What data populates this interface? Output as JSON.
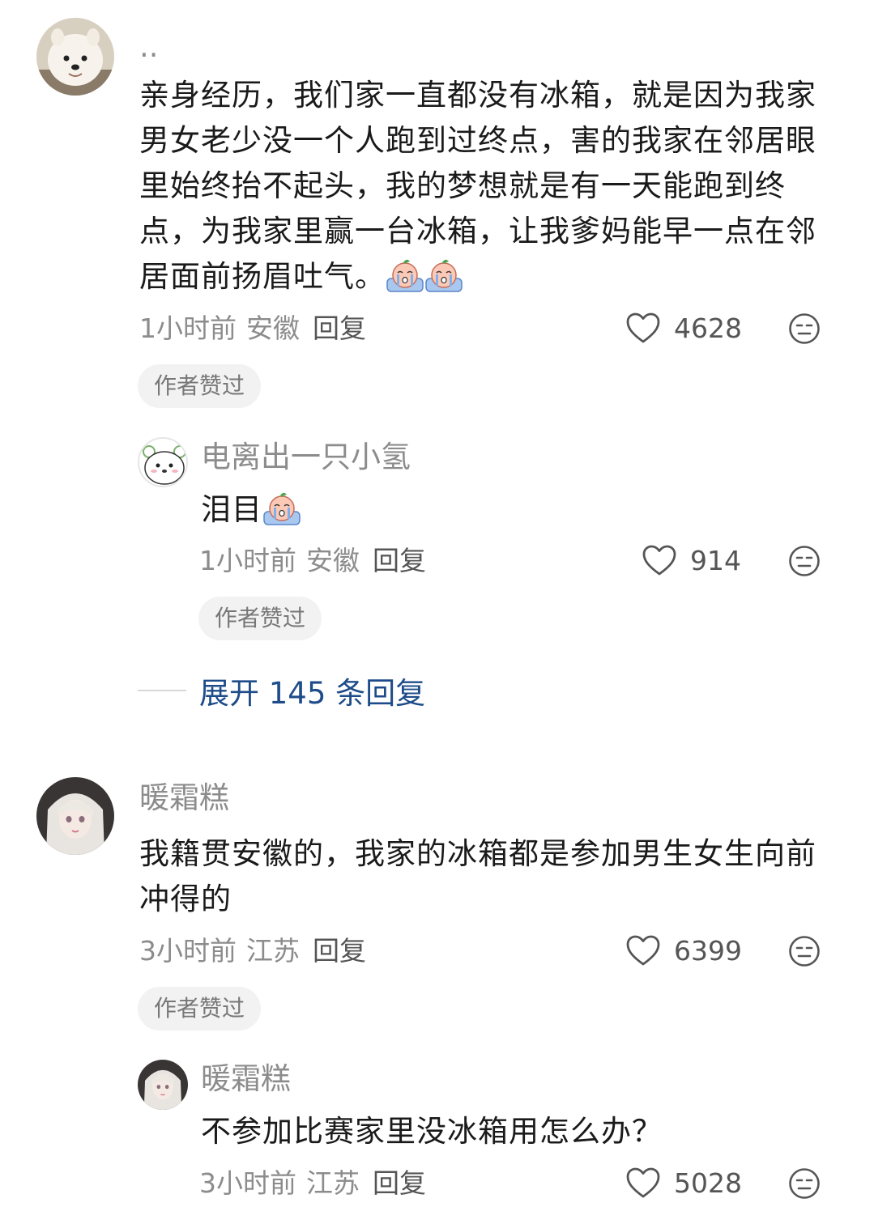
{
  "comments": [
    {
      "username": "..",
      "avatar_icon": "samoyed-dog-avatar",
      "text": "亲身经历，我们家一直都没有冰箱，就是因为我家男女老少没一个人跑到过终点，害的我家在邻居眼里始终抬不起头，我的梦想就是有一天能跑到终点，为我家里赢一台冰箱，让我爹妈能早一点在邻居面前扬眉吐气。",
      "emoji_count": 2,
      "time": "1小时前",
      "location": "安徽",
      "reply_label": "回复",
      "likes": "4628",
      "badge": "作者赞过",
      "reply": {
        "username": "电离出一只小氢",
        "avatar_icon": "white-bear-avatar",
        "text": "泪目",
        "time": "1小时前",
        "location": "安徽",
        "reply_label": "回复",
        "likes": "914",
        "badge": "作者赞过"
      },
      "expand_label": "展开 145 条回复"
    },
    {
      "username": "暖霜糕",
      "avatar_icon": "anime-girl-avatar",
      "text": "我籍贯安徽的，我家的冰箱都是参加男生女生向前冲得的",
      "time": "3小时前",
      "location": "江苏",
      "reply_label": "回复",
      "likes": "6399",
      "badge": "作者赞过",
      "reply": {
        "username": "暖霜糕",
        "avatar_icon": "anime-girl-avatar",
        "text": "不参加比赛家里没冰箱用怎么办？",
        "time": "3小时前",
        "location": "江苏",
        "reply_label": "回复",
        "likes": "5028"
      }
    }
  ]
}
